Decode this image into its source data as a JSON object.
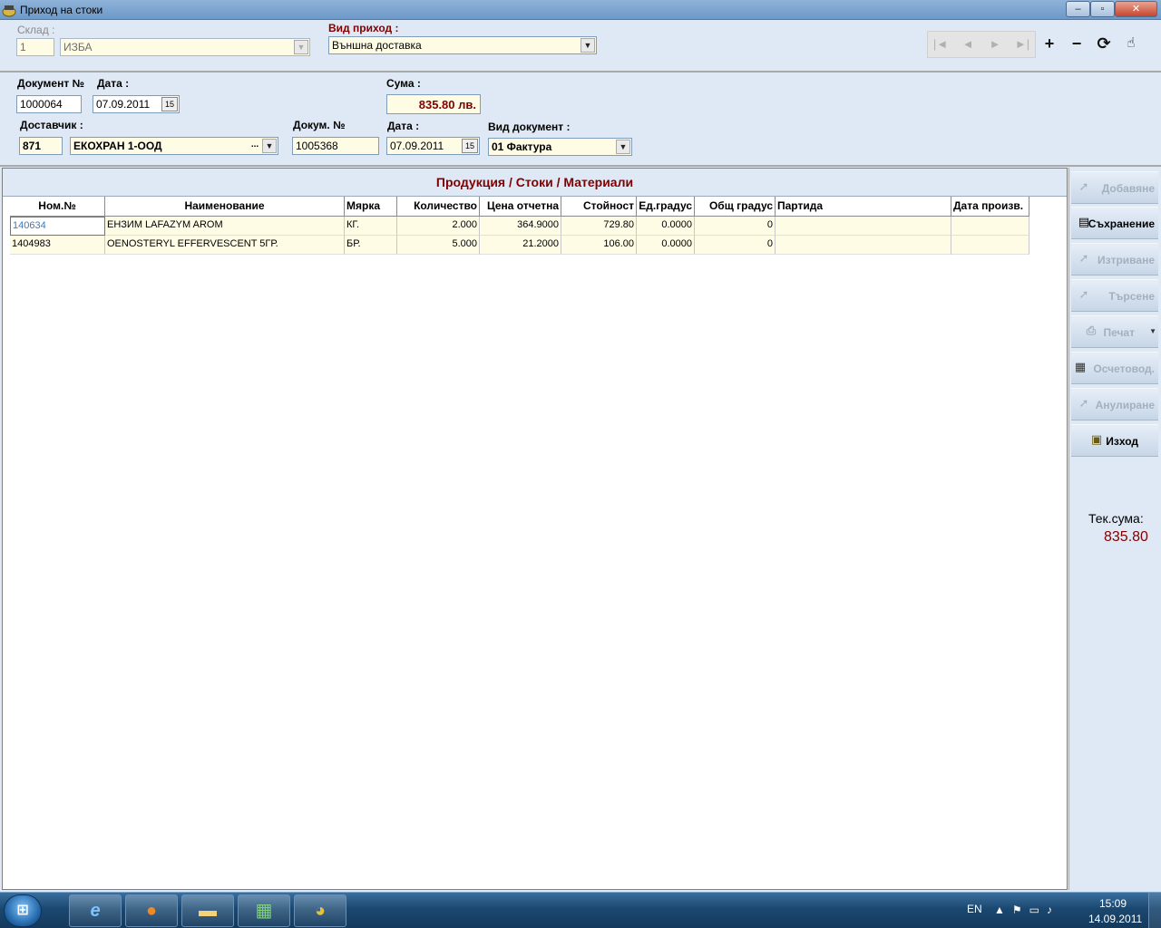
{
  "window": {
    "title": "Приход на стоки",
    "min": "–",
    "max": "▫",
    "close": "✕"
  },
  "header": {
    "warehouse_label": "Склад :",
    "warehouse_code": "1",
    "warehouse_name": "ИЗБА",
    "income_type_label": "Вид приход :",
    "income_type_value": "Външна доставка",
    "nav": {
      "first": "|◄",
      "prev": "◄",
      "next": "►",
      "last": "►|"
    },
    "tools": {
      "add": "+",
      "remove": "−",
      "refresh": "⟳",
      "hand": "☝"
    }
  },
  "document": {
    "doc_no_label": "Документ №",
    "doc_no": "1000064",
    "date_label": "Дата :",
    "date": "07.09.2011",
    "sum_label": "Сума :",
    "sum": "835.80 лв.",
    "supplier_label": "Доставчик :",
    "supplier_code": "871",
    "supplier_name": "ЕКОХРАН 1-ООД",
    "ext_doc_no_label": "Докум. №",
    "ext_doc_no": "1005368",
    "ext_date_label": "Дата :",
    "ext_date": "07.09.2011",
    "doc_type_label": "Вид документ :",
    "doc_type": "01 Фактура",
    "cal_icon": "15",
    "dd_icon": "▼",
    "ellipsis": "..."
  },
  "grid": {
    "title": "Продукция / Стоки / Материали",
    "columns": [
      "Ном.№",
      "Наименование",
      "Мярка",
      "Количество",
      "Цена отчетна",
      "Стойност",
      "Ед.градус",
      "Общ градус",
      "Партида",
      "Дата произв."
    ],
    "rows": [
      [
        "140634",
        "ЕНЗИМ LAFAZYM AROM",
        "КГ.",
        "2.000",
        "364.9000",
        "729.80",
        "0.0000",
        "0",
        "",
        ""
      ],
      [
        "1404983",
        "OENOSTERYL EFFERVESCENT 5ГР.",
        "БР.",
        "5.000",
        "21.2000",
        "106.00",
        "0.0000",
        "0",
        "",
        ""
      ]
    ]
  },
  "actions": {
    "add": "Добавяне",
    "save": "Съхранение",
    "delete": "Изтриване",
    "search": "Търсене",
    "print": "Печат",
    "accounting": "Осчетовод.",
    "cancel": "Анулиране",
    "exit": "Изход"
  },
  "current_sum": {
    "label": "Тек.сума:",
    "value": "835.80"
  },
  "taskbar": {
    "lang": "EN",
    "time": "15:09",
    "date": "14.09.2011"
  }
}
